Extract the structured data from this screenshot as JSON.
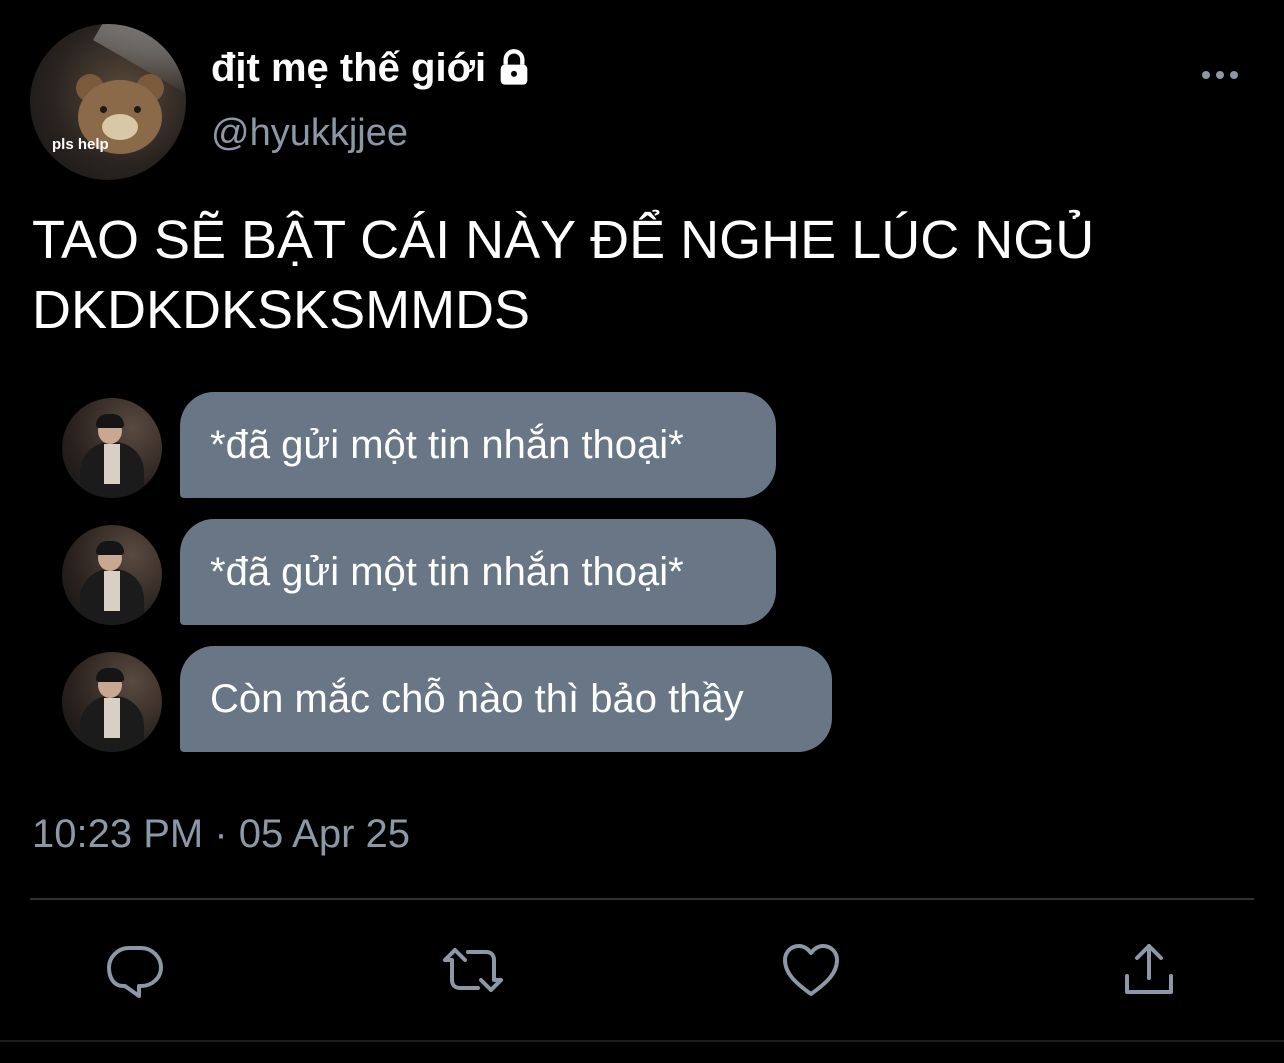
{
  "tweet": {
    "author": {
      "display_name": "địt mẹ thế giới",
      "handle": "@hyukkjjee",
      "avatar_caption": "pls help",
      "protected_icon": "lock-icon"
    },
    "more_icon": "more-horizontal-icon",
    "text": "TAO SẼ BẬT CÁI NÀY ĐỂ NGHE LÚC NGỦ DKDKDKSKSMMDS",
    "messages": [
      {
        "text": "*đã gửi một tin nhắn thoại*"
      },
      {
        "text": "*đã gửi một tin nhắn thoại*"
      },
      {
        "text": "Còn mắc chỗ nào thì bảo thầy"
      }
    ],
    "timestamp": "10:23 PM · 05 Apr 25",
    "actions": {
      "reply_icon": "reply-icon",
      "retweet_icon": "retweet-icon",
      "like_icon": "heart-icon",
      "share_icon": "share-icon"
    }
  },
  "colors": {
    "background": "#000000",
    "text_primary": "#ffffff",
    "text_secondary": "#8b98a5",
    "bubble": "#687686",
    "divider": "#2f3336"
  }
}
